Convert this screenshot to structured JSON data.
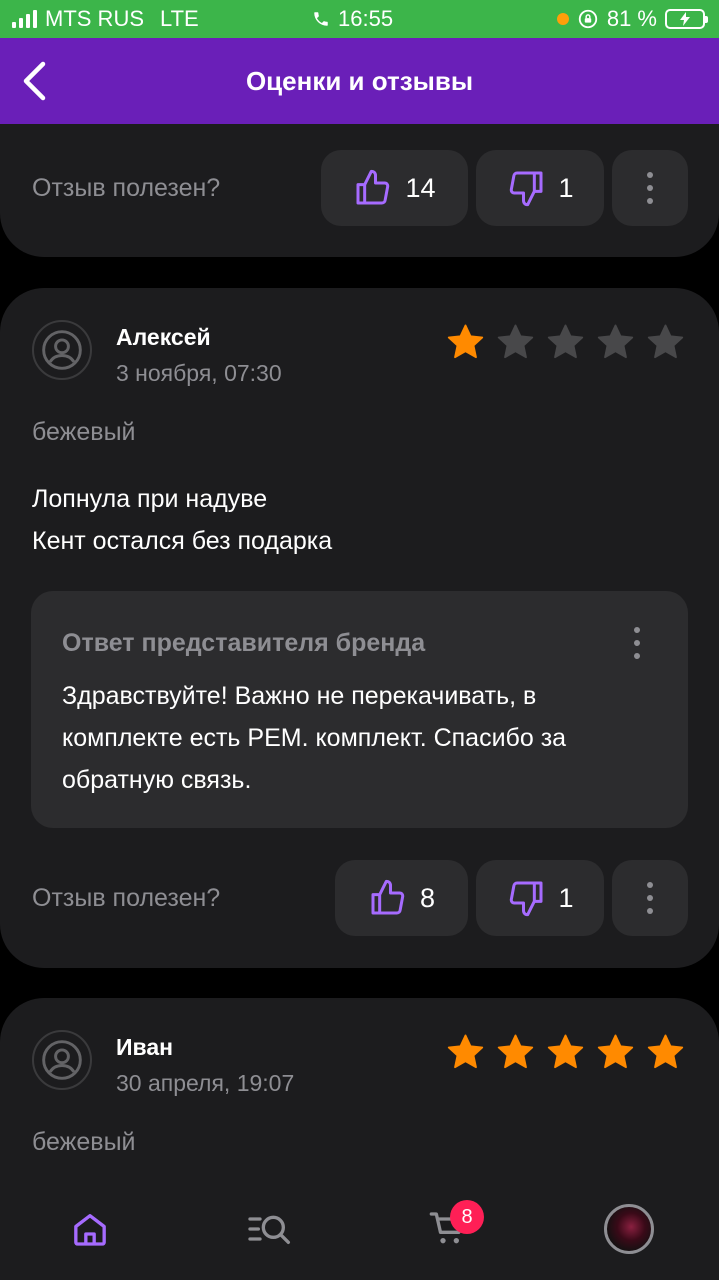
{
  "status_bar": {
    "carrier": "MTS RUS",
    "network": "LTE",
    "time": "16:55",
    "battery_percent": "81 %"
  },
  "header": {
    "title": "Оценки и отзывы",
    "back_icon": "chevron-left-icon"
  },
  "colors": {
    "accent": "#6a1fb8",
    "star_active": "#ff8a00",
    "star_inactive": "#48484a",
    "card_bg": "#1c1c1e",
    "button_bg": "#2c2c2e",
    "badge": "#ff1f56"
  },
  "reviews": [
    {
      "helpful_label": "Отзыв полезен?",
      "likes": "14",
      "dislikes": "1"
    },
    {
      "author": "Алексей",
      "date": "3 ноября, 07:30",
      "rating": 1,
      "max_rating": 5,
      "variant": "бежевый",
      "text_lines": [
        "Лопнула при надуве",
        "Кент остался без подарка"
      ],
      "brand_reply": {
        "title": "Ответ представителя бренда",
        "text": "Здравствуйте! Важно не перекачивать, в комплекте есть РЕМ.  комплект. Спасибо за обратную связь."
      },
      "helpful_label": "Отзыв полезен?",
      "likes": "8",
      "dislikes": "1"
    },
    {
      "author": "Иван",
      "date": "30 апреля, 19:07",
      "rating": 5,
      "max_rating": 5,
      "variant": "бежевый"
    }
  ],
  "bottom_nav": {
    "items": [
      "home-icon",
      "catalog-search-icon",
      "cart-icon",
      "profile-avatar"
    ],
    "cart_badge": "8"
  }
}
